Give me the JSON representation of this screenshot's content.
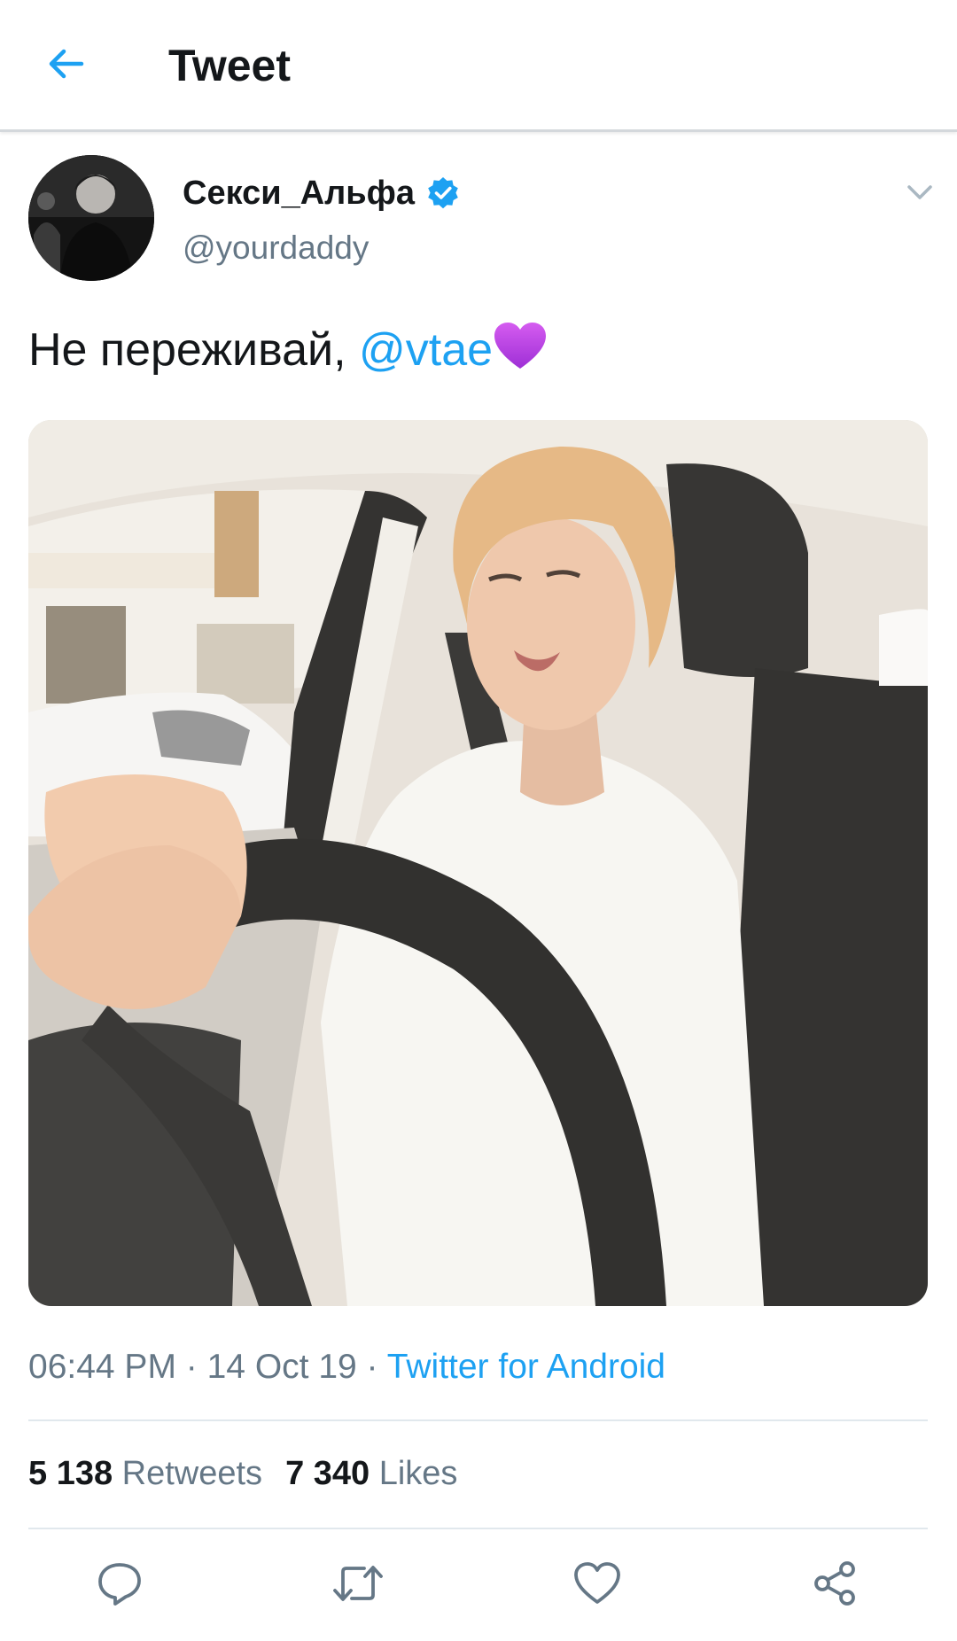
{
  "header": {
    "title": "Tweet",
    "back_icon": "arrow-left-icon"
  },
  "author": {
    "name": "Секси_Альфа",
    "handle": "@yourdaddy",
    "verified": true
  },
  "tweet": {
    "text": "Не переживай, ",
    "mention": "@vtae",
    "emoji": "purple-heart-icon"
  },
  "meta": {
    "time": "06:44 PM",
    "separator": " · ",
    "date": "14 Oct 19",
    "source": "Twitter for Android"
  },
  "stats": {
    "retweets_count": "5 138",
    "retweets_label": "Retweets",
    "likes_count": "7 340",
    "likes_label": "Likes"
  },
  "actions": [
    {
      "name": "reply",
      "icon": "reply-icon"
    },
    {
      "name": "retweet",
      "icon": "retweet-icon"
    },
    {
      "name": "like",
      "icon": "heart-icon"
    },
    {
      "name": "share",
      "icon": "share-icon"
    }
  ],
  "colors": {
    "accent": "#1da1f2",
    "text": "#14171a",
    "secondary": "#657786",
    "divider": "#e1e8ed",
    "icon": "#657786"
  }
}
